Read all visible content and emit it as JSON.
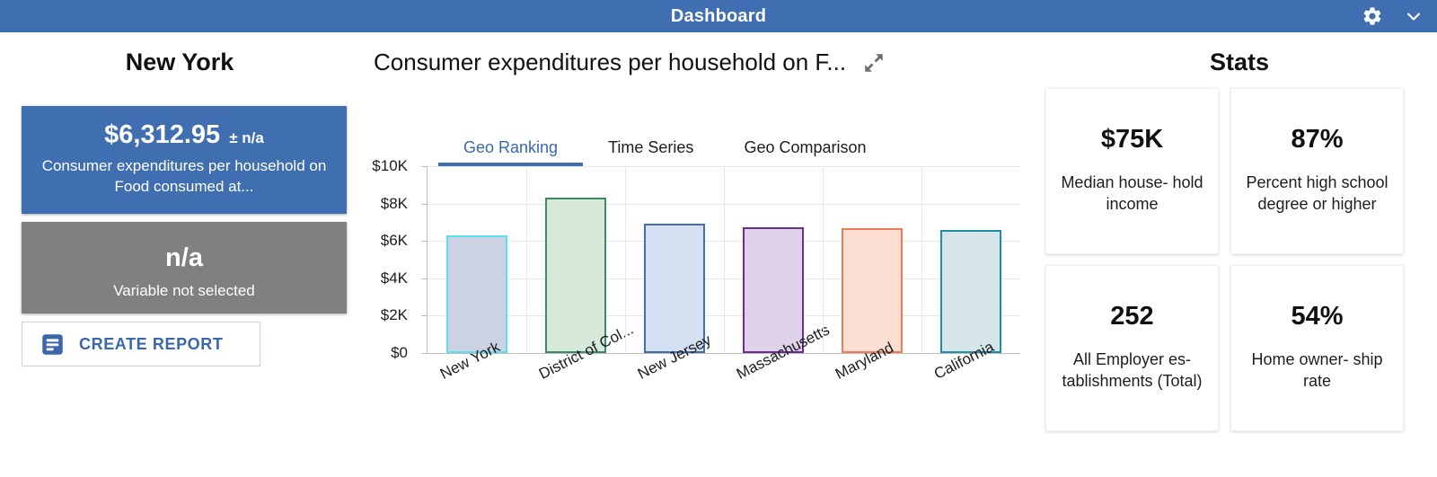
{
  "appbar": {
    "title": "Dashboard",
    "settings_icon": "gear-icon",
    "collapse_icon": "chevron-down-icon",
    "background_color": "#3f6fb0"
  },
  "left_panel": {
    "heading": "New York",
    "kpis": [
      {
        "value": "$6,312.95",
        "margin_of_error": "± n/a",
        "label": "Consumer expenditures per household on Food consumed at...",
        "color": "#3f6fb0"
      },
      {
        "value": "n/a",
        "margin_of_error": "",
        "label": "Variable not selected",
        "color": "#808080"
      }
    ],
    "create_report_button": {
      "label": "CREATE REPORT",
      "icon": "report-document-icon",
      "accent_color": "#3a68aa"
    }
  },
  "center_panel": {
    "chart_title": "Consumer expenditures per household on F...",
    "expand_icon": "expand-fullscreen-icon",
    "tabs": [
      {
        "label": "Geo Ranking",
        "active": true
      },
      {
        "label": "Time Series",
        "active": false
      },
      {
        "label": "Geo Comparison",
        "active": false
      }
    ],
    "active_tab_color": "#3a68aa"
  },
  "chart_data": {
    "type": "bar",
    "title": "Consumer expenditures per household on F...",
    "xlabel": "",
    "ylabel": "",
    "ylim": [
      0,
      10000
    ],
    "yticks": [
      0,
      2000,
      4000,
      6000,
      8000,
      10000
    ],
    "ytick_labels": [
      "$0",
      "$2K",
      "$4K",
      "$6K",
      "$8K",
      "$10K"
    ],
    "grid": true,
    "legend": "none",
    "categories": [
      "New York",
      "District of Col...",
      "New Jersey",
      "Massachusetts",
      "Maryland",
      "California"
    ],
    "values": [
      6313,
      8312,
      6905,
      6745,
      6680,
      6570
    ],
    "bar_colors": [
      {
        "border": "#5be0f0",
        "fill": "#ccd2e4"
      },
      {
        "border": "#3c8b63",
        "fill": "#d7e9db"
      },
      {
        "border": "#3f6fb0",
        "fill": "#d5dff2"
      },
      {
        "border": "#6a2a92",
        "fill": "#dfd1e8"
      },
      {
        "border": "#ef7a54",
        "fill": "#fcdfd2"
      },
      {
        "border": "#1f8fa6",
        "fill": "#d5e5e9"
      }
    ]
  },
  "right_panel": {
    "heading": "Stats",
    "stats": [
      {
        "value": "$75K",
        "label": "Median house-\nhold income"
      },
      {
        "value": "87%",
        "label": "Percent high\nschool degree\nor higher"
      },
      {
        "value": "252",
        "label": "All Employer es-\ntablishments\n(Total)"
      },
      {
        "value": "54%",
        "label": "Home owner-\nship rate"
      }
    ]
  }
}
